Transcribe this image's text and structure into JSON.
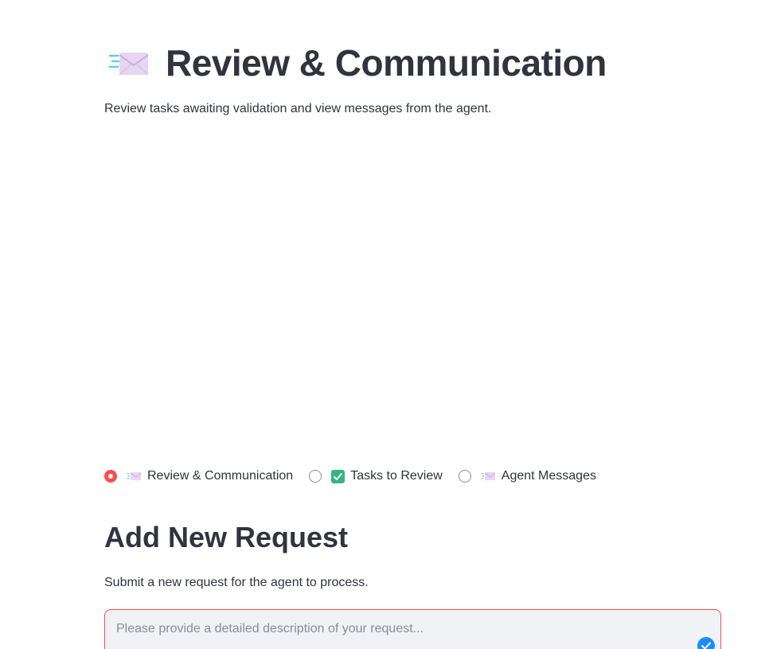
{
  "header": {
    "icon": "incoming-envelope-icon",
    "title": "Review & Communication",
    "subtitle": "Review tasks awaiting validation and view messages from the agent."
  },
  "nav": {
    "selected": 0,
    "options": [
      {
        "icon": "incoming-envelope-icon",
        "label": "Review & Communication"
      },
      {
        "icon": "check-mark-button-icon",
        "label": "Tasks to Review"
      },
      {
        "icon": "incoming-envelope-icon",
        "label": "Agent Messages"
      }
    ]
  },
  "request": {
    "title": "Add New Request",
    "description": "Submit a new request for the agent to process.",
    "placeholder": "Please provide a detailed description of your request...",
    "value": ""
  },
  "colors": {
    "accent": "#ff4b4b",
    "text": "#31333f",
    "input_bg": "#f0f2f6",
    "check_green": "#33b67f",
    "badge_blue": "#1a8cff"
  }
}
